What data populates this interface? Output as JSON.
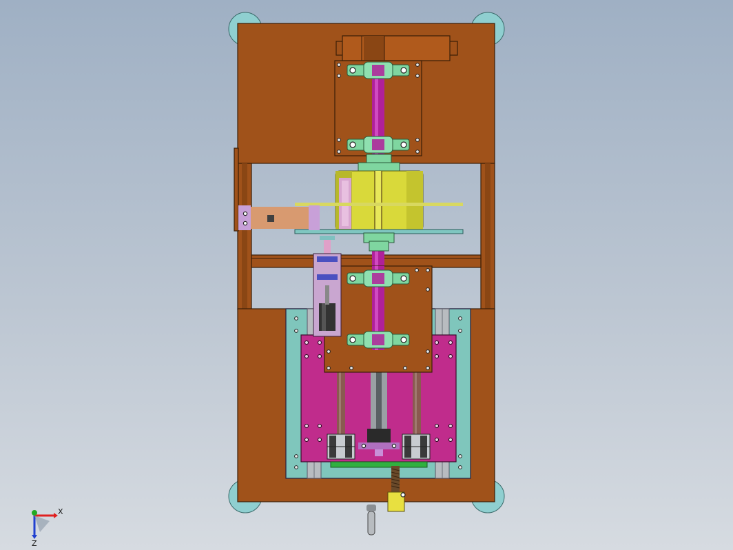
{
  "view": {
    "background_top": "#9fb0c4",
    "background_bottom": "#d6dbe1"
  },
  "triad": {
    "x_label": "X",
    "z_label": "Z",
    "x_color": "#e02020",
    "y_color": "#22aa22",
    "z_color": "#2040d0"
  },
  "colors": {
    "frame_orange": "#a0521a",
    "frame_edge": "#3a1e08",
    "shaft_magenta": "#b0209a",
    "bracket_green": "#7fd6a0",
    "drum_yellow": "#d9d93a",
    "plate_cyan": "#7fc6c0",
    "slide_magenta": "#c02c8c",
    "rail_gray": "#b8bcc0",
    "wheel_cyan": "#8fcfd0",
    "handle_yellow": "#e8e040",
    "lilac": "#c9a6d0",
    "strip_green": "#30b040"
  }
}
